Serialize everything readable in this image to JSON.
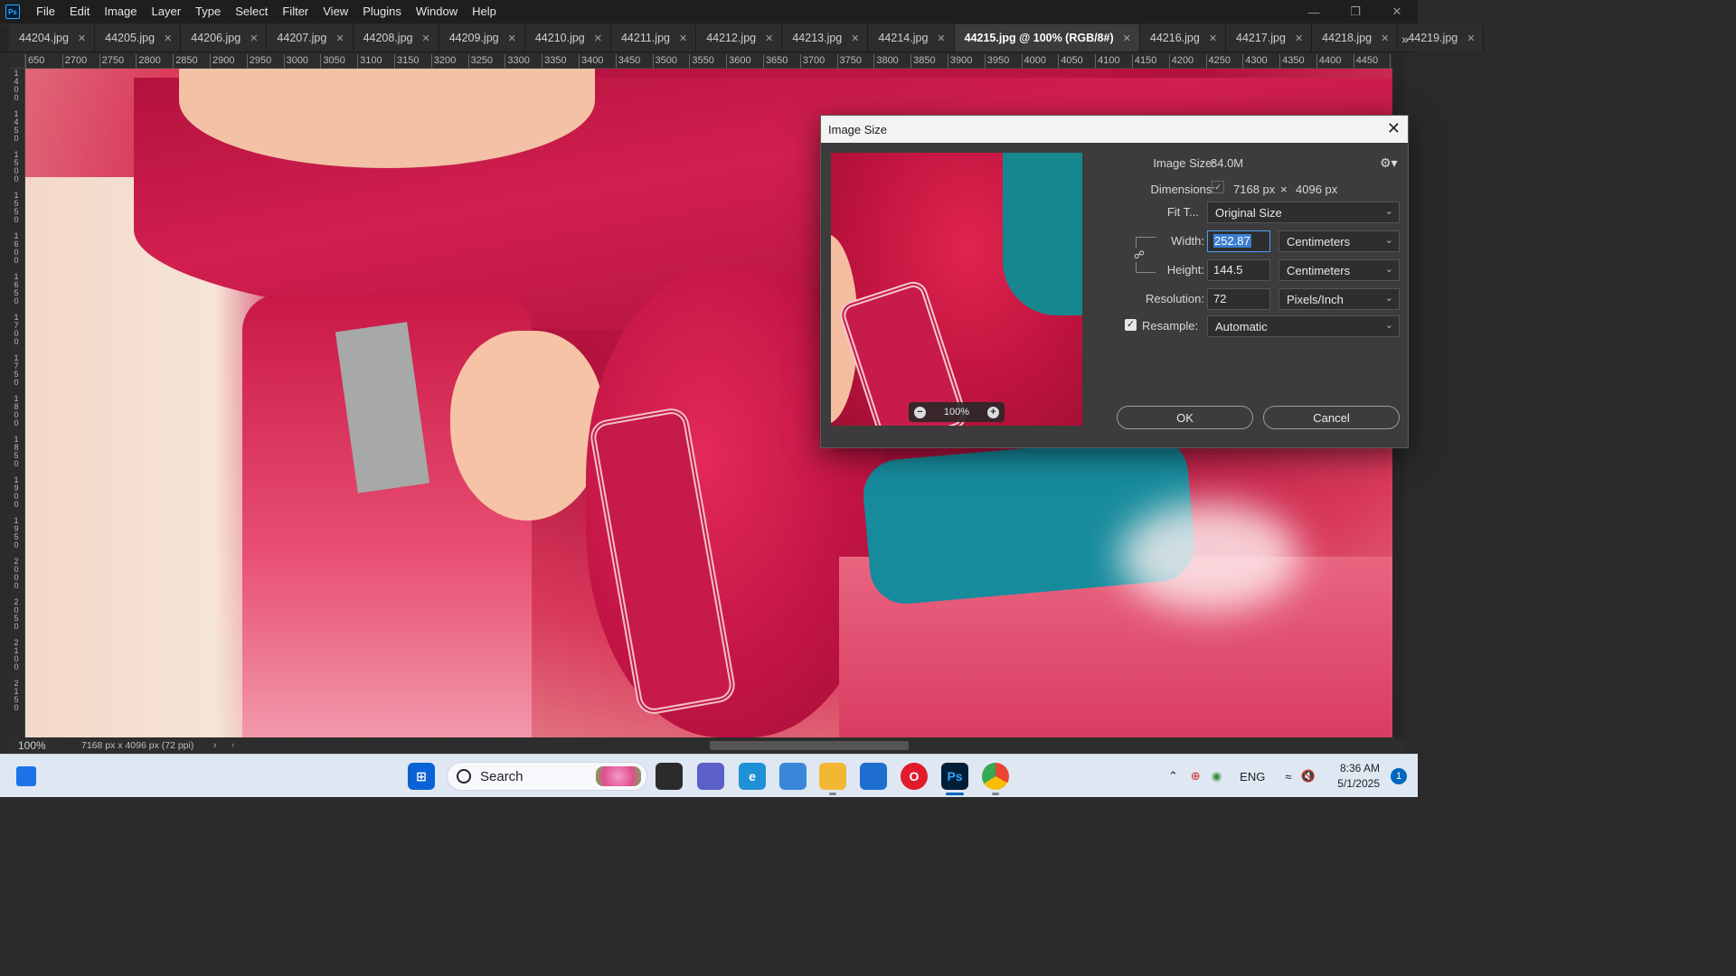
{
  "app": {
    "logo": "Ps",
    "menu": [
      "File",
      "Edit",
      "Image",
      "Layer",
      "Type",
      "Select",
      "Filter",
      "View",
      "Plugins",
      "Window",
      "Help"
    ]
  },
  "tabs": [
    {
      "label": "44204.jpg"
    },
    {
      "label": "44205.jpg"
    },
    {
      "label": "44206.jpg"
    },
    {
      "label": "44207.jpg"
    },
    {
      "label": "44208.jpg"
    },
    {
      "label": "44209.jpg"
    },
    {
      "label": "44210.jpg"
    },
    {
      "label": "44211.jpg"
    },
    {
      "label": "44212.jpg"
    },
    {
      "label": "44213.jpg"
    },
    {
      "label": "44214.jpg"
    },
    {
      "label": "44215.jpg @ 100% (RGB/8#)",
      "active": true
    },
    {
      "label": "44216.jpg"
    },
    {
      "label": "44217.jpg"
    },
    {
      "label": "44218.jpg"
    },
    {
      "label": "44219.jpg"
    }
  ],
  "ruler_top": [
    "650",
    "2700",
    "2750",
    "2800",
    "2850",
    "2900",
    "2950",
    "3000",
    "3050",
    "3100",
    "3150",
    "3200",
    "3250",
    "3300",
    "3350",
    "3400",
    "3450",
    "3500",
    "3550",
    "3600",
    "3650",
    "3700",
    "3750",
    "3800",
    "3850",
    "3900",
    "3950",
    "4000",
    "4050",
    "4100",
    "4150",
    "4200",
    "4250",
    "4300",
    "4350",
    "4400",
    "4450",
    "4"
  ],
  "ruler_left": "1400 1450 1500 1550 1600 1650 1700 1750 1800 1850 1900 1950 2000 2050 2100 2150 2200 2250 2300 2350 2400",
  "status": {
    "zoom": "100%",
    "info": "7168 px x 4096 px (72 ppi)"
  },
  "dialog": {
    "title": "Image Size",
    "preview_zoom": "100%",
    "image_size_label": "Image Size:",
    "image_size_value": "84.0M",
    "dimensions_label": "Dimensions:",
    "dim_width": "7168 px",
    "dim_times": "×",
    "dim_height": "4096 px",
    "fit_label": "Fit T...",
    "fit_value": "Original Size",
    "width_label": "Width:",
    "width_value": "252.87",
    "width_unit": "Centimeters",
    "height_label": "Height:",
    "height_value": "144.5",
    "height_unit": "Centimeters",
    "resolution_label": "Resolution:",
    "resolution_value": "72",
    "resolution_unit": "Pixels/Inch",
    "resample_label": "Resample:",
    "resample_checked": true,
    "resample_value": "Automatic",
    "ok_label": "OK",
    "cancel_label": "Cancel"
  },
  "taskbar": {
    "search_label": "Search",
    "lang": "ENG",
    "time": "8:36 AM",
    "date": "5/1/2025",
    "notifications": "1"
  }
}
